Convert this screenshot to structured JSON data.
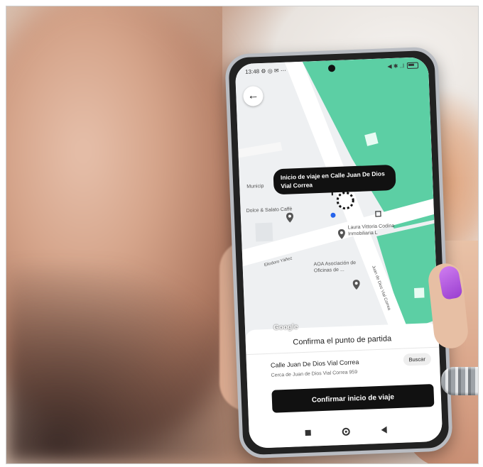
{
  "status_bar": {
    "time": "13:48",
    "icons_left": "⚙ ◎ ✉ ⋯",
    "icons_right": "◀ ✱ ..l"
  },
  "map": {
    "watermark": "",
    "pickup_tooltip": "Inicio de viaje en Calle Juan De Dios Vial Correa",
    "labels": {
      "place_top": "Municip",
      "cafe": "Dolce & Salato Caffè",
      "realty": "Laura Vittoria Codina Inmobiliaria L",
      "association": "AOA Asociación de Oficinas de ...",
      "street_eliodoro": "Eliodoro Yáñez",
      "street_juan": "Juan de Dios Vial Correa"
    },
    "google_logo": "Google",
    "colors": {
      "park": "#5ccfa4",
      "road": "#ffffff",
      "block": "#e9ecef"
    }
  },
  "sheet": {
    "title": "Confirma el punto de partida",
    "address_main": "Calle Juan De Dios Vial Correa",
    "address_sub": "Cerca de Juan de Dios Vial Correa 959",
    "search_button": "Buscar",
    "confirm_button": "Confirmar inicio de viaje"
  },
  "icons": [
    "back-arrow-icon",
    "location-pin-icon",
    "home-nav-icon",
    "recent-apps-icon",
    "back-nav-icon"
  ]
}
